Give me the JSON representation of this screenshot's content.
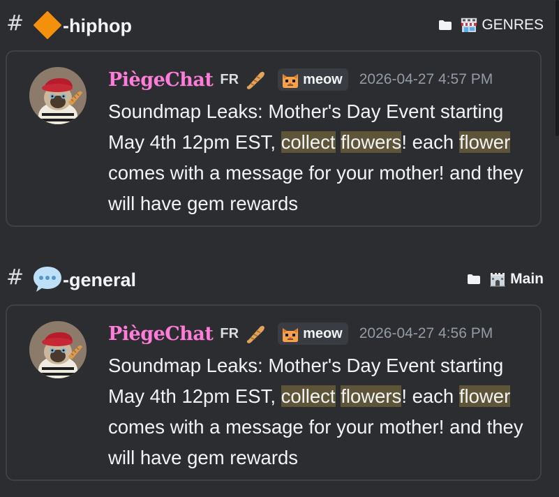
{
  "results": [
    {
      "channel": {
        "hash": "#",
        "name": "-hiphop",
        "emoji": "orange-diamond-icon",
        "category_label": "GENRES",
        "category_emoji": "shop-icon"
      },
      "message": {
        "username": "PiègeChat",
        "tag": "FR",
        "tag_emoji": "baguette-icon",
        "role": "meow",
        "timestamp": "2026-04-27 4:57 PM",
        "body": {
          "t1": "Soundmap Leaks: Mother's Day Event starting May 4th 12pm EST, ",
          "h1": "collect",
          "t2": " ",
          "h2": "flowers",
          "t3": "! each ",
          "h3": "flower",
          "t4": " comes with a message for your mother! and they will have gem rewards"
        }
      }
    },
    {
      "channel": {
        "hash": "#",
        "name": "-general",
        "emoji": "speech-balloon-icon",
        "category_label": "Main",
        "category_emoji": "castle-icon"
      },
      "message": {
        "username": "PiègeChat",
        "tag": "FR",
        "tag_emoji": "baguette-icon",
        "role": "meow",
        "timestamp": "2026-04-27 4:56 PM",
        "body": {
          "t1": "Soundmap Leaks: Mother's Day Event starting May 4th 12pm EST, ",
          "h1": "collect",
          "t2": " ",
          "h2": "flowers",
          "t3": "! each ",
          "h3": "flower",
          "t4": " comes with a message for your mother! and they will have gem rewards"
        }
      }
    }
  ],
  "colors": {
    "background": "#2b2d31",
    "card_border": "#3f4147",
    "username": "#ff7dd8",
    "highlight": "#5e5437",
    "timestamp": "#949ba4"
  }
}
